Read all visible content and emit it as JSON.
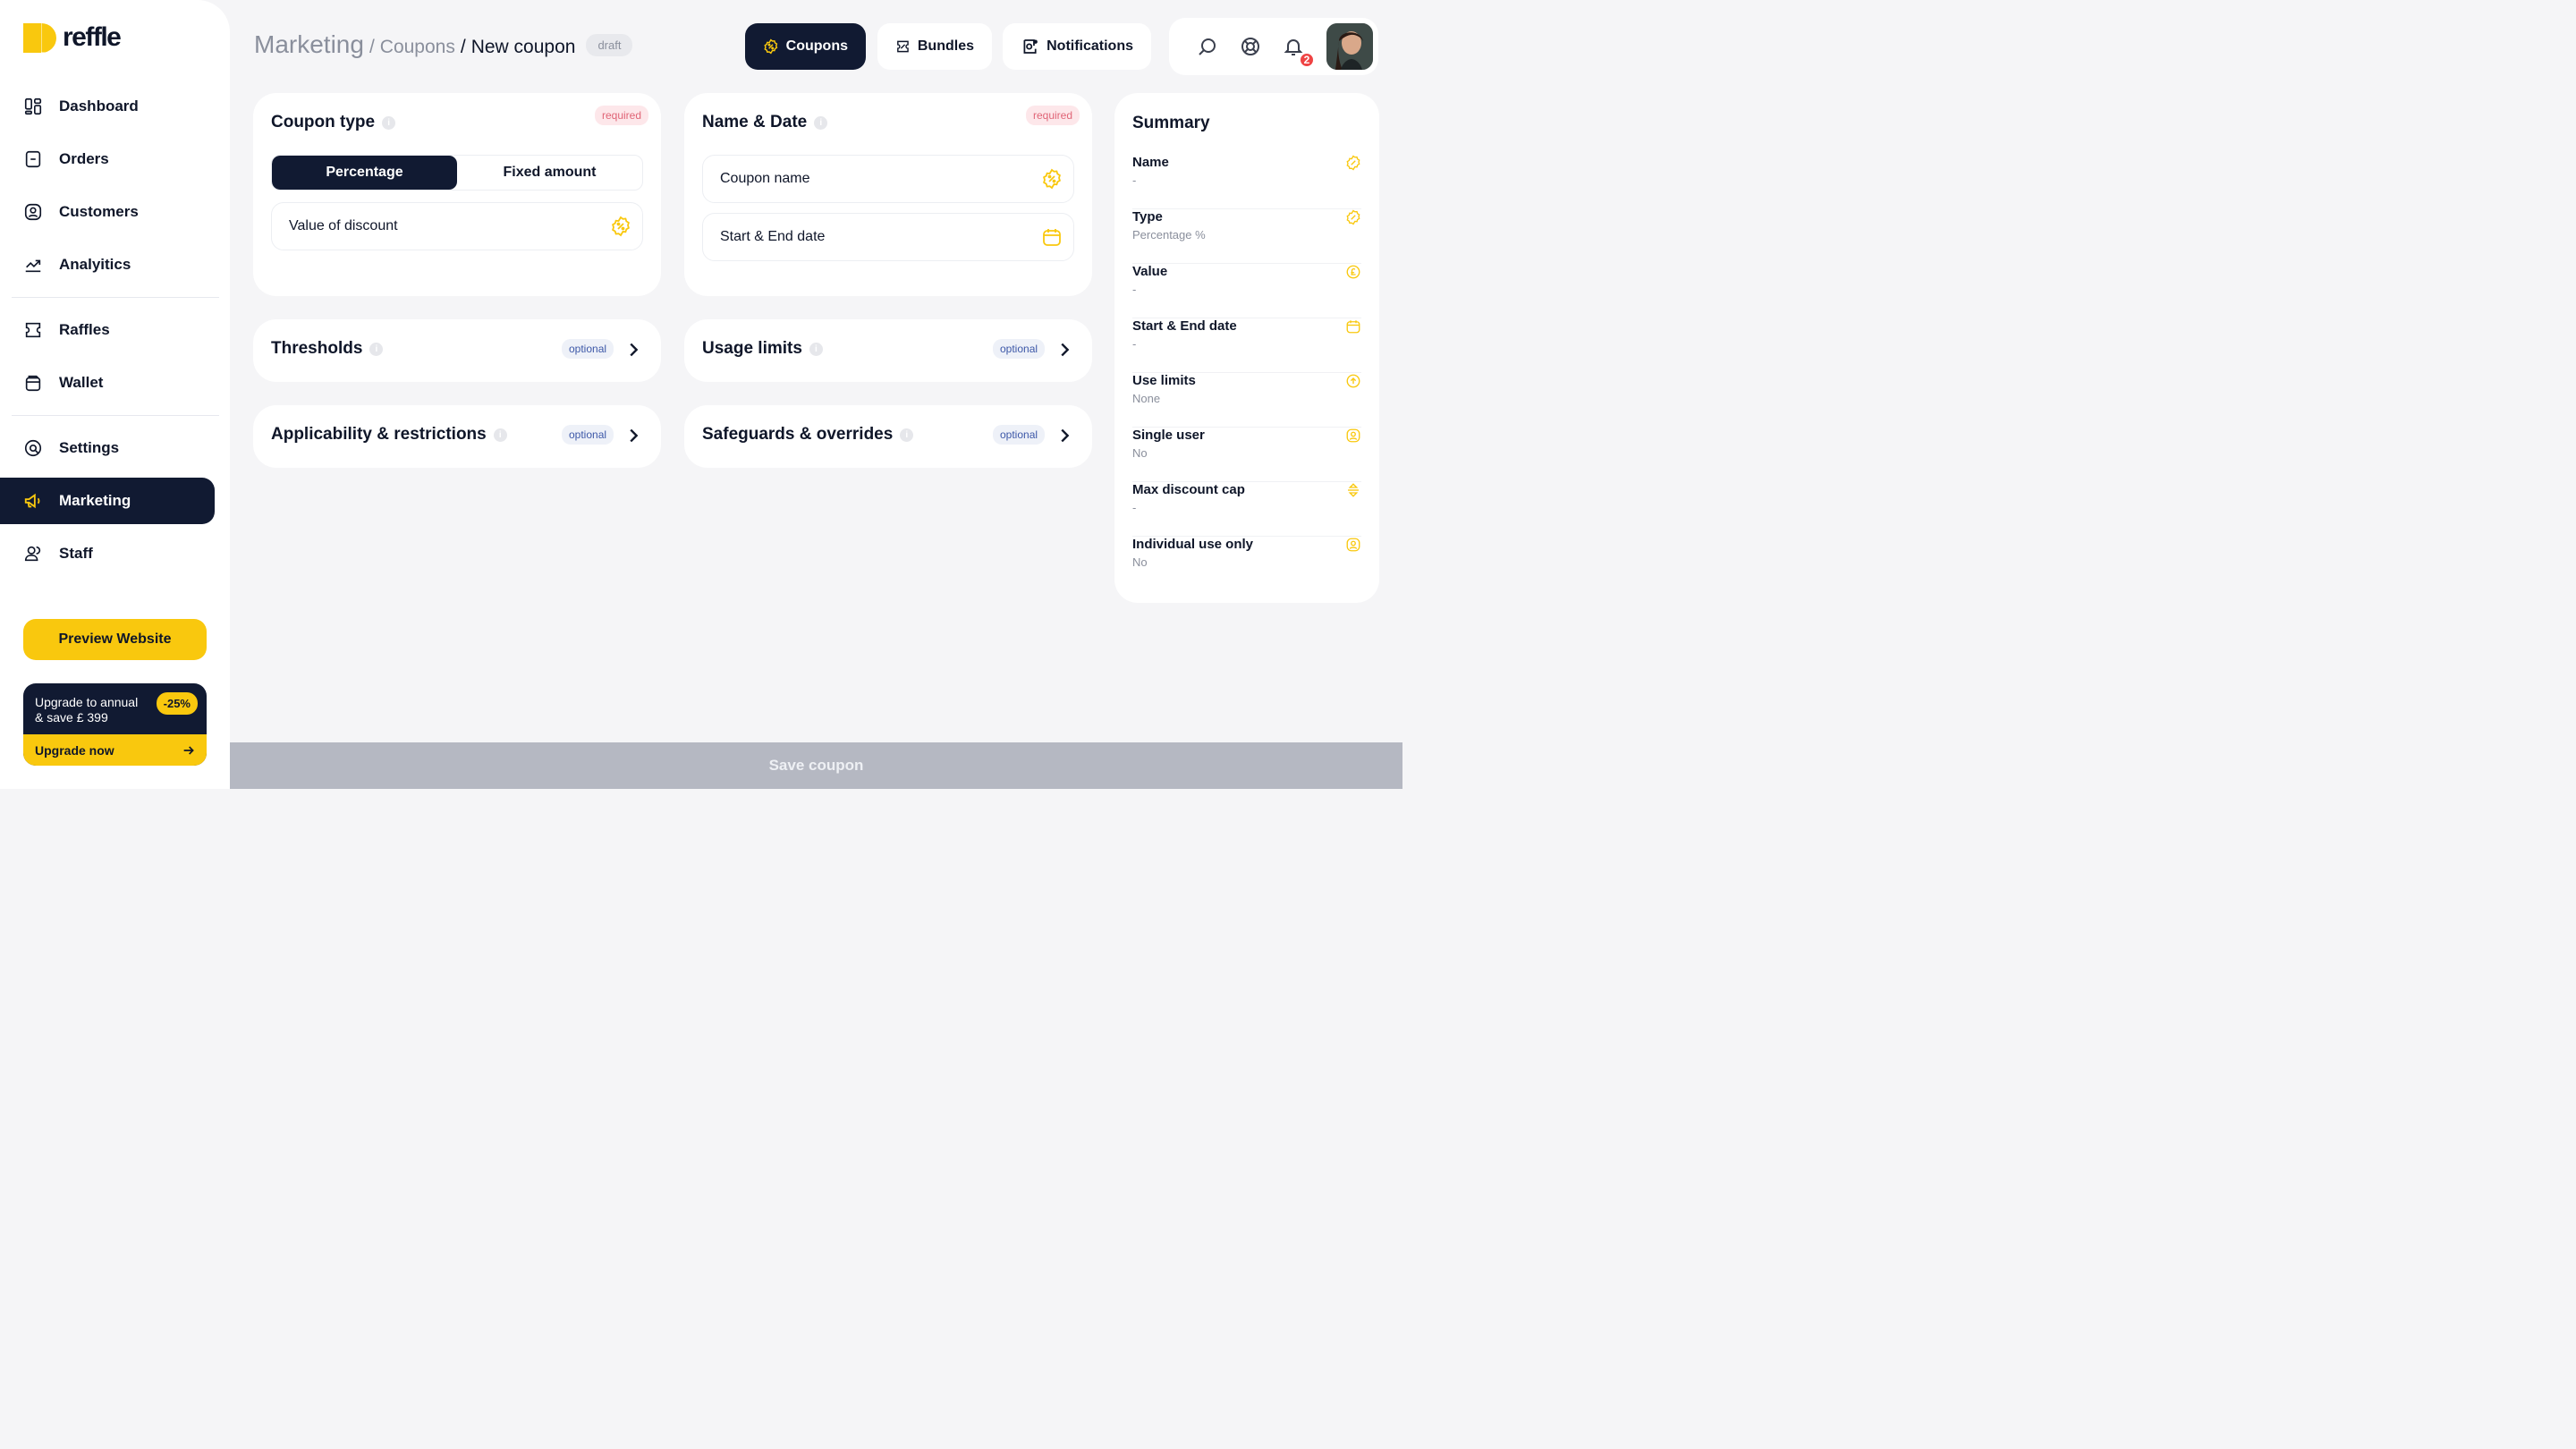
{
  "brand": {
    "name": "reffle",
    "accent": "#f9c80e",
    "dark": "#111a32"
  },
  "sidebar": {
    "items": [
      {
        "label": "Dashboard",
        "icon": "dashboard-icon"
      },
      {
        "label": "Orders",
        "icon": "orders-icon"
      },
      {
        "label": "Customers",
        "icon": "customers-icon"
      },
      {
        "label": "Analyitics",
        "icon": "analytics-icon"
      },
      {
        "label": "Raffles",
        "icon": "ticket-icon"
      },
      {
        "label": "Wallet",
        "icon": "wallet-icon"
      },
      {
        "label": "Settings",
        "icon": "settings-icon"
      },
      {
        "label": "Marketing",
        "icon": "megaphone-icon",
        "active": true
      },
      {
        "label": "Staff",
        "icon": "staff-icon"
      }
    ],
    "preview_button": "Preview Website",
    "upgrade": {
      "text_line1": "Upgrade to annual",
      "text_line2": "& save £ 399",
      "badge": "-25%",
      "cta": "Upgrade now"
    }
  },
  "header": {
    "breadcrumb": {
      "root": "Marketing",
      "sep": "/",
      "mid": "Coupons",
      "current": "New coupon"
    },
    "status_badge": "draft",
    "tabs": [
      {
        "label": "Coupons",
        "icon": "coupon-icon",
        "active": true
      },
      {
        "label": "Bundles",
        "icon": "bundle-icon"
      },
      {
        "label": "Notifications",
        "icon": "notification-icon"
      }
    ],
    "notification_count": "2"
  },
  "coupon_type": {
    "title": "Coupon type",
    "required_label": "required",
    "options": [
      "Percentage",
      "Fixed amount"
    ],
    "selected": "Percentage",
    "value_field_placeholder": "Value of discount"
  },
  "name_date": {
    "title": "Name & Date",
    "required_label": "required",
    "name_placeholder": "Coupon name",
    "date_placeholder": "Start & End date"
  },
  "sections": [
    {
      "title": "Thresholds",
      "badge": "optional"
    },
    {
      "title": "Usage limits",
      "badge": "optional"
    },
    {
      "title": "Applicability & restrictions",
      "badge": "optional"
    },
    {
      "title": "Safeguards & overrides",
      "badge": "optional"
    }
  ],
  "summary": {
    "title": "Summary",
    "rows": [
      {
        "label": "Name",
        "value": "-",
        "icon": "coupon-icon"
      },
      {
        "label": "Type",
        "value": "Percentage %",
        "icon": "coupon-icon"
      },
      {
        "label": "Value",
        "value": "-",
        "icon": "currency-icon"
      },
      {
        "label": "Start & End date",
        "value": "-",
        "icon": "calendar-icon"
      },
      {
        "label": "Use limits",
        "value": "None",
        "icon": "limit-icon"
      },
      {
        "label": "Single user",
        "value": "No",
        "icon": "user-icon"
      },
      {
        "label": "Max discount cap",
        "value": "-",
        "icon": "cap-icon"
      },
      {
        "label": "Individual use only",
        "value": "No",
        "icon": "user-icon"
      }
    ]
  },
  "footer": {
    "save_label": "Save coupon"
  }
}
